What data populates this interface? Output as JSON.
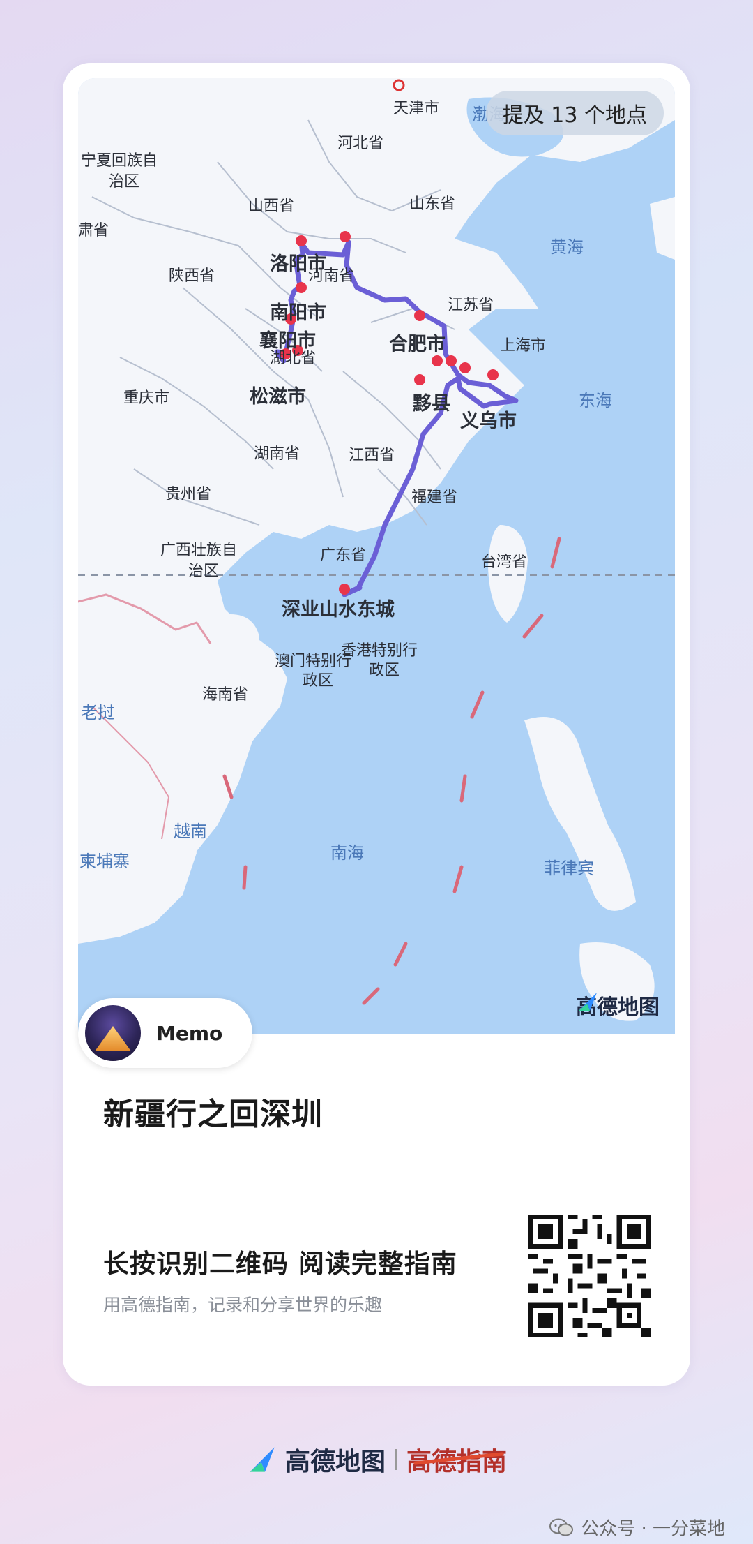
{
  "map": {
    "poi_count_label": "提及 13 个地点",
    "logo_text": "高德地图",
    "labels": {
      "tianjin": "天津市",
      "bohai": "渤海",
      "hebei": "河北省",
      "ningxia_1": "宁夏回族自",
      "ningxia_2": "治区",
      "shanxi": "山西省",
      "shandong": "山东省",
      "gansu": "肃省",
      "huanghai": "黄海",
      "luoyang": "洛阳市",
      "henan": "河南省",
      "shaanxi": "陕西省",
      "nanyang": "南阳市",
      "jiangsu": "江苏省",
      "xiangyang": "襄阳市",
      "hefei": "合肥市",
      "shanghai": "上海市",
      "hubei": "湖北省",
      "songzi": "松滋市",
      "chongqing": "重庆市",
      "yixian": "黟县",
      "donghai": "东海",
      "yiwu": "义乌市",
      "hunan": "湖南省",
      "jiangxi": "江西省",
      "guizhou": "贵州省",
      "fujian": "福建省",
      "guangxi_1": "广西壮族自",
      "guangxi_2": "治区",
      "guangdong": "广东省",
      "taiwan": "台湾省",
      "shenzhen_poi": "深业山水东城",
      "macau_1": "澳门特别行",
      "macau_2": "政区",
      "hongkong_1": "香港特别行",
      "hongkong_2": "政区",
      "hainan": "海南省",
      "laos": "老挝",
      "vietnam": "越南",
      "cambodia": "柬埔寨",
      "nanhai": "南海",
      "philippines": "菲律宾"
    }
  },
  "memo": {
    "name": "Memo"
  },
  "title": "新疆行之回深圳",
  "cta": "长按识别二维码 阅读完整指南",
  "subtitle": "用高德指南，记录和分享世界的乐趣",
  "brand": {
    "amap": "高德地图",
    "guide": "高德指南"
  },
  "watermark": "公众号 · 一分菜地",
  "colors": {
    "route": "#6b5fd6",
    "marker": "#e8344b",
    "sea": "#aed2f6",
    "land": "#f4f6fa"
  },
  "icons": {
    "map_logo": "amap-logo-icon",
    "qr": "qr-code",
    "wechat": "wechat-icon"
  }
}
